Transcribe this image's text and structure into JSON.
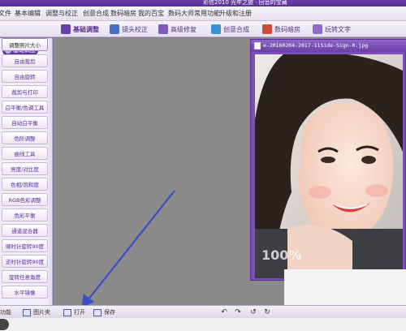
{
  "window": {
    "title": "彩信2010 光年之旅 · 回音的宝藏"
  },
  "menu": [
    {
      "label": "文件"
    },
    {
      "label": "基本编辑"
    },
    {
      "label": "调整与校正"
    },
    {
      "label": "创意合成"
    },
    {
      "label": "数码暗房"
    },
    {
      "label": "我的百宝"
    },
    {
      "label": "数码大师常用功能"
    },
    {
      "label": "升级和注册"
    }
  ],
  "toolbar": [
    {
      "label": "基础调整",
      "icon": "adjust-icon",
      "active": true
    },
    {
      "label": "镜头校正",
      "icon": "lens-icon",
      "active": false
    },
    {
      "label": "高级修复",
      "icon": "repair-icon",
      "active": false
    },
    {
      "label": "创意合成",
      "icon": "compose-icon",
      "active": false
    },
    {
      "label": "数码暗房",
      "icon": "darkroom-icon",
      "active": false
    },
    {
      "label": "玩转文字",
      "icon": "text-icon",
      "active": false
    }
  ],
  "sidebar": {
    "header": "基础调整",
    "items": [
      {
        "label": "调整照片大小"
      },
      {
        "label": "自由裁剪"
      },
      {
        "label": "自由旋转"
      },
      {
        "label": "裁剪与打印"
      },
      {
        "label": "白平衡/色调工具"
      },
      {
        "label": "自动白平衡"
      },
      {
        "label": "色阶调整"
      },
      {
        "label": "曲线工具"
      },
      {
        "label": "亮度/对比度"
      },
      {
        "label": "色相/饱和度"
      },
      {
        "label": "RGB色彩调整"
      },
      {
        "label": "色彩平衡"
      },
      {
        "label": "通道混合器"
      },
      {
        "label": "顺时针旋转90度"
      },
      {
        "label": "逆时针旋转90度"
      },
      {
        "label": "旋转任意角度"
      },
      {
        "label": "水平镜像"
      }
    ]
  },
  "image_window": {
    "filename": "e-20160204-2017-11Side-Sign-0.jpg",
    "zoom": "100%"
  },
  "statusbar": {
    "left_function": "功能",
    "browse": "图片夹",
    "open": "打开",
    "save": "保存"
  },
  "colors": {
    "accent": "#5a2f95",
    "arrow": "#3b4fc4"
  }
}
